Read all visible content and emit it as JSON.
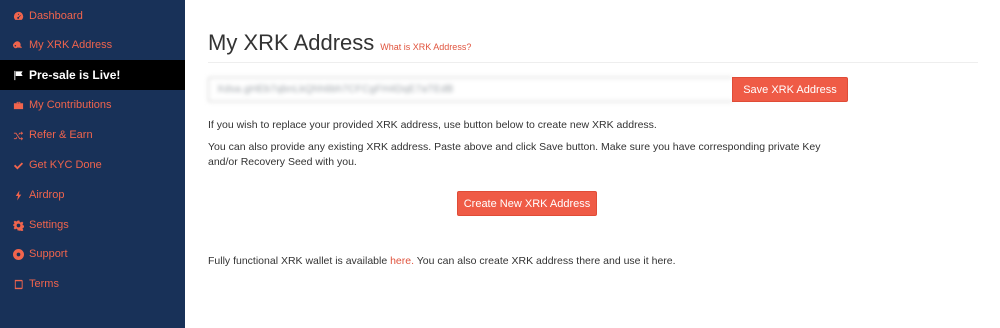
{
  "sidebar": {
    "items": [
      {
        "label": "Dashboard",
        "icon": "dashboard-icon",
        "active": false
      },
      {
        "label": "My XRK Address",
        "icon": "key-icon",
        "active": false
      },
      {
        "label": "Pre-sale is Live!",
        "icon": "flag-icon",
        "active": true
      },
      {
        "label": "My Contributions",
        "icon": "briefcase-icon",
        "active": false
      },
      {
        "label": "Refer & Earn",
        "icon": "shuffle-icon",
        "active": false
      },
      {
        "label": "Get KYC Done",
        "icon": "check-icon",
        "active": false
      },
      {
        "label": "Airdrop",
        "icon": "bolt-icon",
        "active": false
      },
      {
        "label": "Settings",
        "icon": "gear-icon",
        "active": false
      },
      {
        "label": "Support",
        "icon": "lifebuoy-icon",
        "active": false
      },
      {
        "label": "Terms",
        "icon": "book-icon",
        "active": false
      }
    ]
  },
  "main": {
    "title": "My XRK Address",
    "help_link": "What is XRK Address?",
    "address_value": "Xdsa.gHEb7qbnLkQhh6bh7CFCgFH4DqE7aTEdB",
    "save_button": "Save XRK Address",
    "para1": "If you wish to replace your provided XRK address, use button below to create new XRK address.",
    "para2": "You can also provide any existing XRK address. Paste above and click Save button. Make sure you have corresponding private Key and/or Recovery Seed with you.",
    "create_button": "Create New XRK Address",
    "para3_before": "Fully functional XRK wallet is available ",
    "para3_link": "here.",
    "para3_after": " You can also create XRK address there and use it here."
  },
  "colors": {
    "sidebar_bg": "#183158",
    "accent": "#ef5b46",
    "active_bg": "#000000"
  }
}
